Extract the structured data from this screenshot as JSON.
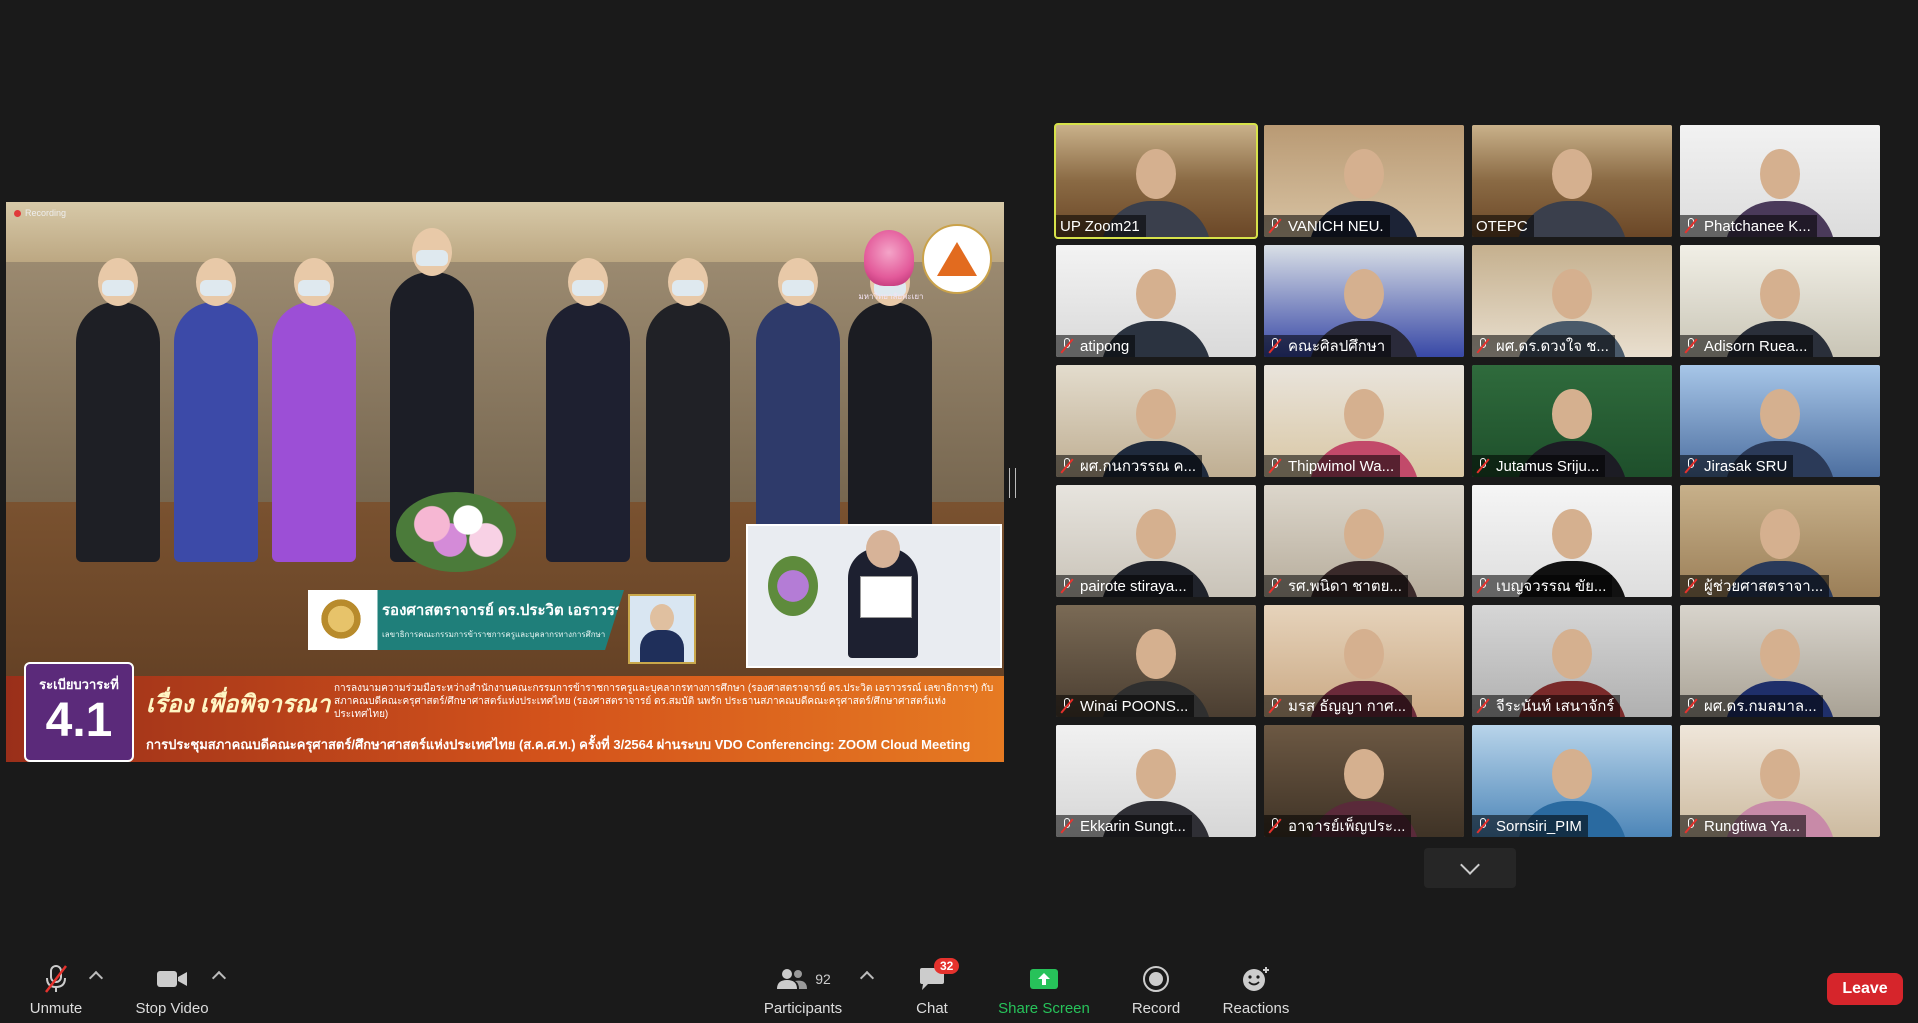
{
  "shared_screen": {
    "recording_label": "Recording",
    "logo_caption": "มหาวิทยาลัยพะเยา",
    "nameplate_name": "รองศาสตราจารย์ ดร.ประวิต เอราวรรณ์",
    "nameplate_title": "เลขาธิการคณะกรรมการข้าราชการครูและบุคลากรทางการศึกษา",
    "agenda_label": "ระเบียบวาระที่",
    "agenda_number": "4.1",
    "agenda_topic": "เรื่อง เพื่อพิจารณา",
    "agenda_description": "การลงนามความร่วมมือระหว่างสำนักงานคณะกรรมการข้าราชการครูและบุคลากรทางการศึกษา (รองศาสตราจารย์ ดร.ประวิต เอราวรรณ์ เลขาธิการฯ) กับสภาคณบดีคณะครุศาสตร์/ศึกษาศาสตร์แห่งประเทศไทย (รองศาสตราจารย์ ดร.สมบัติ นพรัก ประธานสภาคณบดีคณะครุศาสตร์/ศึกษาศาสตร์แห่งประเทศไทย)",
    "meeting_line": "การประชุมสภาคณบดีคณะครุศาสตร์/ศึกษาศาสตร์แห่งประเทศไทย (ส.ค.ศ.ท.) ครั้งที่ 3/2564  ผ่านระบบ VDO Conferencing: ZOOM Cloud Meeting"
  },
  "gallery": {
    "tiles": [
      {
        "name": "UP Zoom21",
        "muted": false,
        "active": true
      },
      {
        "name": "VANICH NEU.",
        "muted": true
      },
      {
        "name": "OTEPC",
        "muted": false
      },
      {
        "name": "Phatchanee K...",
        "muted": true
      },
      {
        "name": "atipong",
        "muted": true
      },
      {
        "name": "คณะศิลปศึกษา",
        "muted": true
      },
      {
        "name": "ผศ.ดร.ดวงใจ  ช...",
        "muted": true
      },
      {
        "name": "Adisorn Ruea...",
        "muted": true
      },
      {
        "name": "ผศ.กนกวรรณ ค...",
        "muted": true
      },
      {
        "name": "Thipwimol Wa...",
        "muted": true
      },
      {
        "name": "Jutamus Sriju...",
        "muted": true
      },
      {
        "name": "Jirasak SRU",
        "muted": true
      },
      {
        "name": "pairote stiraya...",
        "muted": true
      },
      {
        "name": "รศ.พนิดา ชาตย...",
        "muted": true
      },
      {
        "name": "เบญจวรรณ ขัย...",
        "muted": true
      },
      {
        "name": "ผู้ช่วยศาสตราจา...",
        "muted": true
      },
      {
        "name": "Winai POONS...",
        "muted": true
      },
      {
        "name": "มรส ธัญญา กาศ...",
        "muted": true
      },
      {
        "name": "จีระนันท์ เสนาจักร์",
        "muted": true
      },
      {
        "name": "ผศ.ดร.กมลมาล...",
        "muted": true
      },
      {
        "name": "Ekkarin Sungt...",
        "muted": true
      },
      {
        "name": "อาจารย์เพ็ญประ...",
        "muted": true
      },
      {
        "name": "Sornsiri_PIM",
        "muted": true
      },
      {
        "name": "Rungtiwa Ya...",
        "muted": true
      }
    ]
  },
  "toolbar": {
    "unmute_label": "Unmute",
    "stop_video_label": "Stop Video",
    "participants_label": "Participants",
    "participants_count": "92",
    "chat_label": "Chat",
    "chat_badge": "32",
    "share_screen_label": "Share Screen",
    "record_label": "Record",
    "reactions_label": "Reactions",
    "leave_label": "Leave"
  },
  "colors": {
    "active_speaker_border": "#d7e24a",
    "share_screen_green": "#27c25a",
    "leave_red": "#d6252b",
    "muted_red": "#e5322d"
  }
}
